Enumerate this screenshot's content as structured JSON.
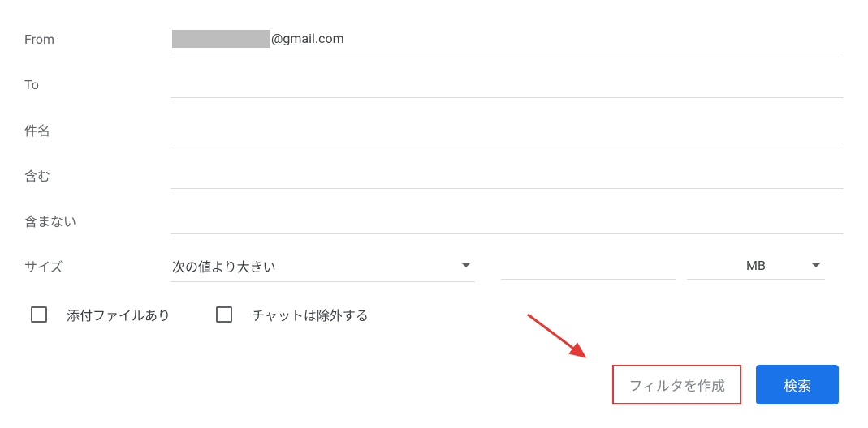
{
  "labels": {
    "from": "From",
    "to": "To",
    "subject": "件名",
    "includes": "含む",
    "excludes": "含まない",
    "size": "サイズ"
  },
  "fields": {
    "from_redacted": true,
    "from_suffix": "@gmail.com",
    "to": "",
    "subject": "",
    "includes": "",
    "excludes": "",
    "size_operator": "次の値より大きい",
    "size_value": "",
    "size_unit": "MB"
  },
  "checkboxes": {
    "has_attachment_label": "添付ファイルあり",
    "has_attachment_checked": false,
    "exclude_chat_label": "チャットは除外する",
    "exclude_chat_checked": false
  },
  "buttons": {
    "create_filter": "フィルタを作成",
    "search": "検索"
  },
  "annotation": {
    "arrow_color": "#e53935",
    "highlight_box": true
  }
}
